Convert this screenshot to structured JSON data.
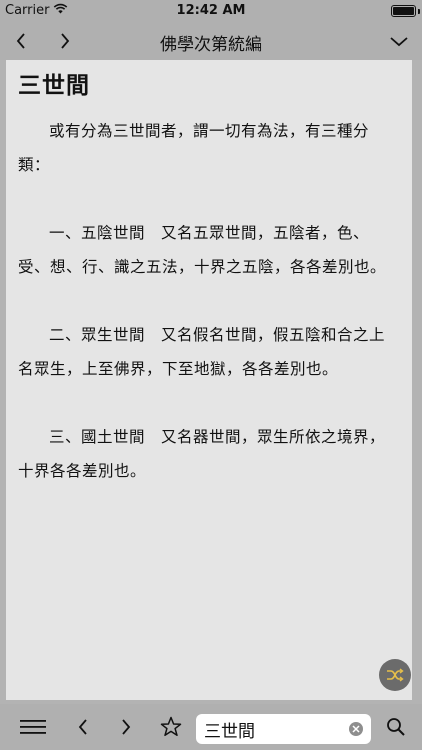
{
  "status_bar": {
    "carrier": "Carrier",
    "time": "12:42 AM"
  },
  "nav": {
    "title": "佛學次第統編"
  },
  "article": {
    "heading": "三世間",
    "paragraphs": [
      "或有分為三世間者，謂一切有為法，有三種分類：",
      "一、五陰世間　又名五眾世間，五陰者，色、受、想、行、識之五法，十界之五陰，各各差別也。",
      "二、眾生世間　又名假名世間，假五陰和合之上名眾生，上至佛界，下至地獄，各各差別也。",
      "三、國土世間　又名器世間，眾生所依之境界，十界各各差別也。"
    ]
  },
  "toolbar": {
    "search_value": "三世間"
  },
  "colors": {
    "bar_bg": "#b0b0b0",
    "content_bg": "#e5e5e5",
    "shuffle_accent": "#e8c04a"
  },
  "icons": [
    "wifi-icon",
    "battery-icon",
    "chevron-left-icon",
    "chevron-right-icon",
    "chevron-down-icon",
    "shuffle-icon",
    "menu-icon",
    "star-icon",
    "clear-icon",
    "search-icon"
  ]
}
